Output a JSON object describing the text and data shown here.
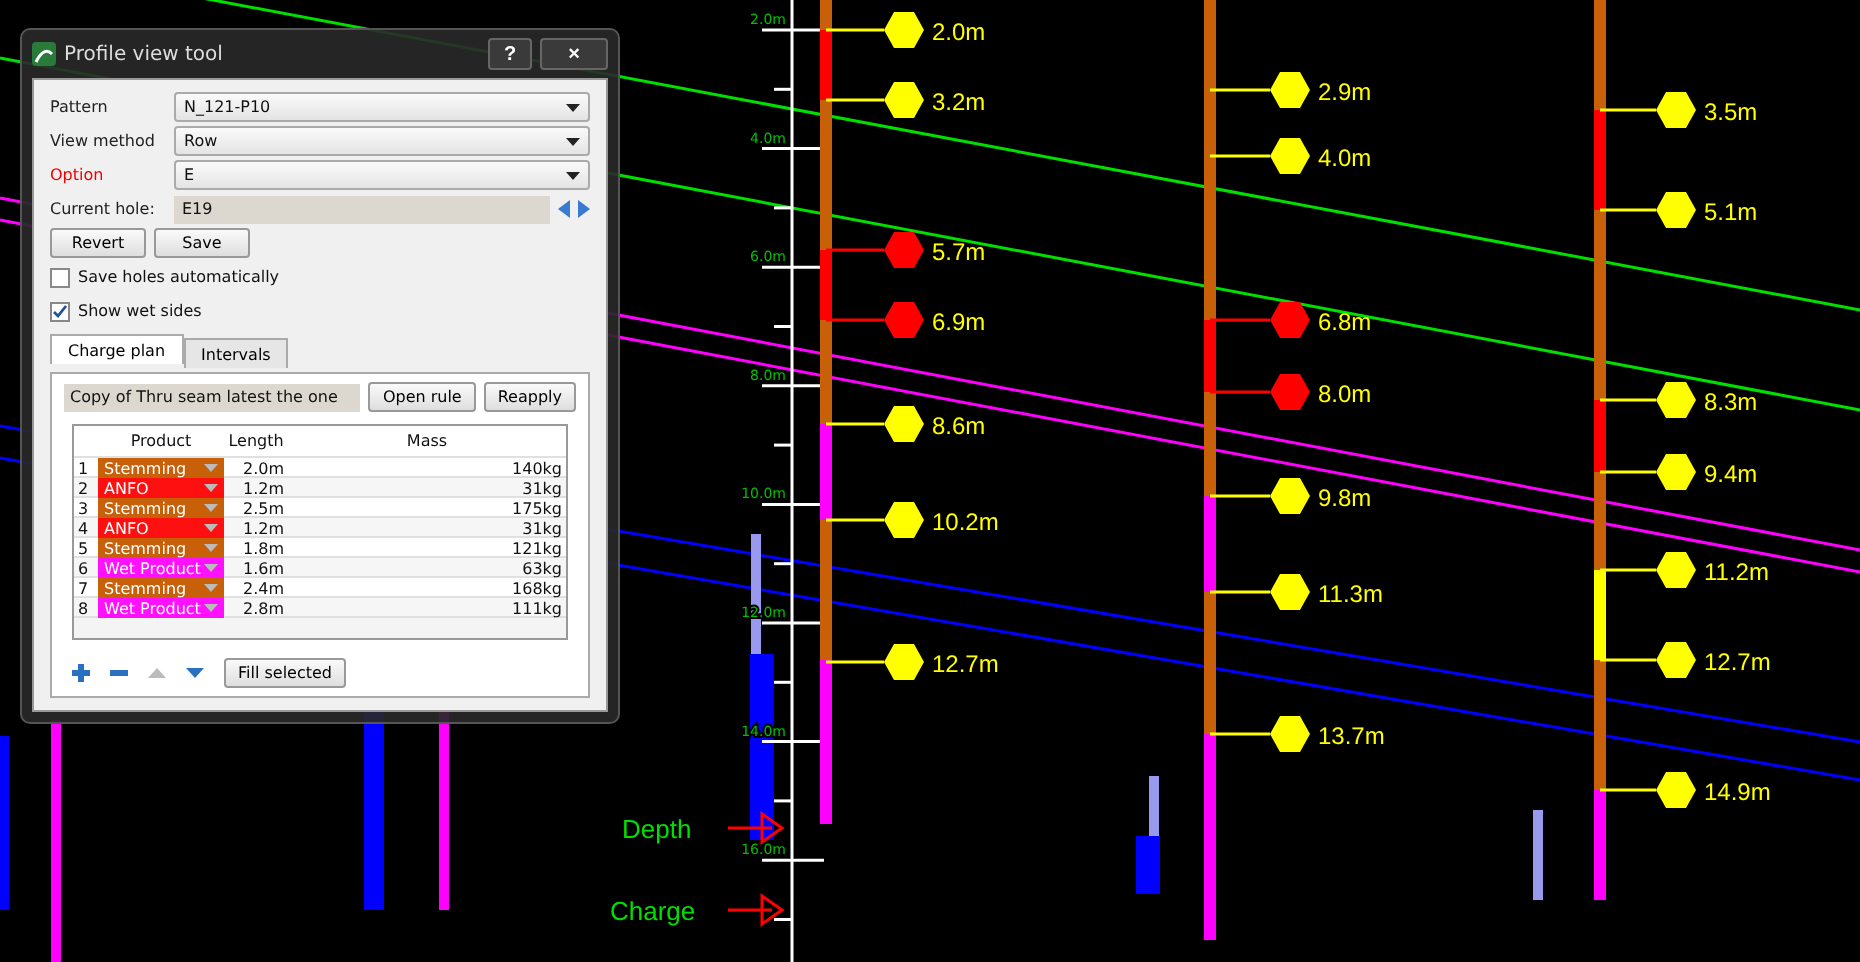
{
  "dialog": {
    "title": "Profile view tool",
    "help": "?",
    "close": "×",
    "fields": [
      {
        "label": "Pattern",
        "value": "N_121-P10",
        "highlighted": false
      },
      {
        "label": "View method",
        "value": "Row",
        "highlighted": false
      },
      {
        "label": "Option",
        "value": "E",
        "highlighted": true
      }
    ],
    "current_hole": {
      "label": "Current hole:",
      "value": "E19"
    },
    "buttons": [
      "Revert",
      "Save"
    ],
    "checkboxes": [
      {
        "label": "Save holes automatically",
        "checked": false
      },
      {
        "label": "Show wet sides",
        "checked": true
      }
    ],
    "tabs": [
      {
        "label": "Charge plan",
        "selected": true
      },
      {
        "label": "Intervals",
        "selected": false
      }
    ],
    "rule": {
      "value": "Copy of Thru seam latest the one",
      "buttons": [
        "Open rule",
        "Reapply"
      ]
    },
    "table": {
      "columns": [
        "Product",
        "Length",
        "Mass"
      ],
      "rows": [
        {
          "index": "1",
          "product": "Stemming",
          "color": "#c8600a",
          "length": "2.0m",
          "mass": "140kg"
        },
        {
          "index": "2",
          "product": "ANFO",
          "color": "#ff1010",
          "length": "1.2m",
          "mass": "31kg"
        },
        {
          "index": "3",
          "product": "Stemming",
          "color": "#c8600a",
          "length": "2.5m",
          "mass": "175kg"
        },
        {
          "index": "4",
          "product": "ANFO",
          "color": "#ff1010",
          "length": "1.2m",
          "mass": "31kg"
        },
        {
          "index": "5",
          "product": "Stemming",
          "color": "#c8600a",
          "length": "1.8m",
          "mass": "121kg"
        },
        {
          "index": "6",
          "product": "Wet Product",
          "color": "#ff10ff",
          "length": "1.6m",
          "mass": "63kg"
        },
        {
          "index": "7",
          "product": "Stemming",
          "color": "#c8600a",
          "length": "2.4m",
          "mass": "168kg"
        },
        {
          "index": "8",
          "product": "Wet Product",
          "color": "#ff10ff",
          "length": "2.8m",
          "mass": "111kg"
        }
      ]
    },
    "fill_button": "Fill selected"
  },
  "canvas": {
    "scale_labels": [
      "2.0m",
      "4.0m",
      "6.0m",
      "8.0m",
      "10.0m",
      "12.0m",
      "14.0m",
      "16.0m"
    ],
    "holes": [
      {
        "decks": [
          {
            "color": "#c8600a"
          },
          {
            "color": "#ff0000"
          },
          {
            "color": "#c8600a"
          },
          {
            "color": "#ff0000"
          },
          {
            "color": "#c8600a"
          },
          {
            "color": "#ff00ff"
          },
          {
            "color": "#c8600a"
          },
          {
            "color": "#ff00ff"
          }
        ],
        "markers": [
          {
            "label": "2.0m",
            "color": "#ffff00"
          },
          {
            "label": "3.2m",
            "color": "#ffff00"
          },
          {
            "label": "5.7m",
            "color": "#ff0000"
          },
          {
            "label": "6.9m",
            "color": "#ff0000"
          },
          {
            "label": "8.6m",
            "color": "#ffff00"
          },
          {
            "label": "10.2m",
            "color": "#ffff00"
          },
          {
            "label": "12.7m",
            "color": "#ffff00"
          }
        ]
      },
      {
        "decks": [
          {
            "color": "#c8600a"
          },
          {
            "color": "#ff0000"
          },
          {
            "color": "#c8600a"
          },
          {
            "color": "#ff00ff"
          },
          {
            "color": "#c8600a"
          },
          {
            "color": "#ff00ff"
          }
        ],
        "markers": [
          {
            "label": "2.9m",
            "color": "#ffff00"
          },
          {
            "label": "4.0m",
            "color": "#ffff00"
          },
          {
            "label": "6.8m",
            "color": "#ff0000"
          },
          {
            "label": "8.0m",
            "color": "#ff0000"
          },
          {
            "label": "9.8m",
            "color": "#ffff00"
          },
          {
            "label": "11.3m",
            "color": "#ffff00"
          },
          {
            "label": "13.7m",
            "color": "#ffff00"
          }
        ]
      },
      {
        "decks": [
          {
            "color": "#c8600a"
          },
          {
            "color": "#ff0000"
          },
          {
            "color": "#c8600a"
          },
          {
            "color": "#ff0000"
          },
          {
            "color": "#c8600a"
          },
          {
            "color": "#ffff00"
          },
          {
            "color": "#c8600a"
          },
          {
            "color": "#ff00ff"
          }
        ],
        "markers": [
          {
            "label": "3.5m",
            "color": "#ffff00"
          },
          {
            "label": "5.1m",
            "color": "#ffff00"
          },
          {
            "label": "8.3m",
            "color": "#ffff00"
          },
          {
            "label": "9.4m",
            "color": "#ffff00"
          },
          {
            "label": "11.2m",
            "color": "#ffff00"
          },
          {
            "label": "12.7m",
            "color": "#ffff00"
          },
          {
            "label": "14.9m",
            "color": "#ffff00"
          }
        ]
      }
    ],
    "legend": [
      "Depth",
      "Charge"
    ]
  }
}
